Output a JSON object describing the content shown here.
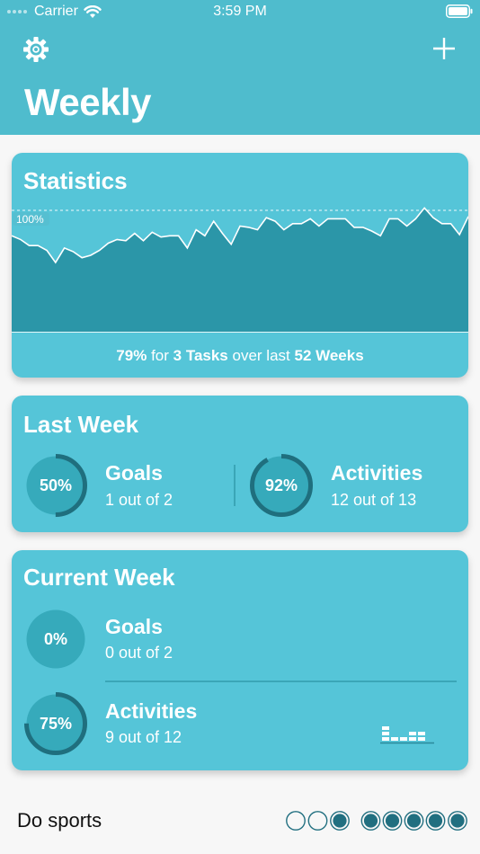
{
  "status_bar": {
    "carrier": "Carrier",
    "time": "3:59 PM"
  },
  "header": {
    "title": "Weekly",
    "settings_icon": "gear-icon",
    "add_icon": "plus-icon"
  },
  "statistics": {
    "title": "Statistics",
    "max_label": "100%",
    "footer": {
      "percent": "79%",
      "for": "for",
      "tasks": "3 Tasks",
      "over": "over last",
      "weeks": "52 Weeks"
    }
  },
  "last_week": {
    "title": "Last Week",
    "goals": {
      "percent_label": "50%",
      "fraction": 0.5,
      "title": "Goals",
      "sub": "1 out of 2"
    },
    "activities": {
      "percent_label": "92%",
      "fraction": 0.92,
      "title": "Activities",
      "sub": "12 out of 13"
    }
  },
  "current_week": {
    "title": "Current Week",
    "goals": {
      "percent_label": "0%",
      "fraction": 0.0,
      "title": "Goals",
      "sub": "0 out of 2"
    },
    "activities": {
      "percent_label": "75%",
      "fraction": 0.75,
      "title": "Activities",
      "sub": "9 out of 12"
    },
    "daily_activity_counts": [
      3,
      1,
      1,
      2,
      2
    ]
  },
  "task": {
    "name": "Do sports",
    "dots": [
      false,
      false,
      true,
      true,
      true,
      true,
      true,
      true
    ]
  },
  "colors": {
    "header": "#4fbccd",
    "card": "#55c5d8",
    "ring_track": "#36aabb",
    "ring_fill": "#1f6f7e",
    "chart_fill": "#2b96a8",
    "dot_fill": "#216f80"
  },
  "chart_data": {
    "type": "area",
    "ylim": [
      0,
      100
    ],
    "reference_line": 100,
    "values": [
      79,
      76,
      71,
      71,
      67,
      57,
      69,
      66,
      61,
      63,
      67,
      73,
      76,
      75,
      81,
      75,
      82,
      78,
      79,
      79,
      69,
      84,
      79,
      91,
      81,
      72,
      87,
      86,
      84,
      94,
      91,
      84,
      89,
      89,
      93,
      87,
      93,
      93,
      93,
      86,
      86,
      83,
      79,
      93,
      93,
      87,
      93,
      102,
      94,
      89,
      89,
      80,
      95
    ]
  }
}
